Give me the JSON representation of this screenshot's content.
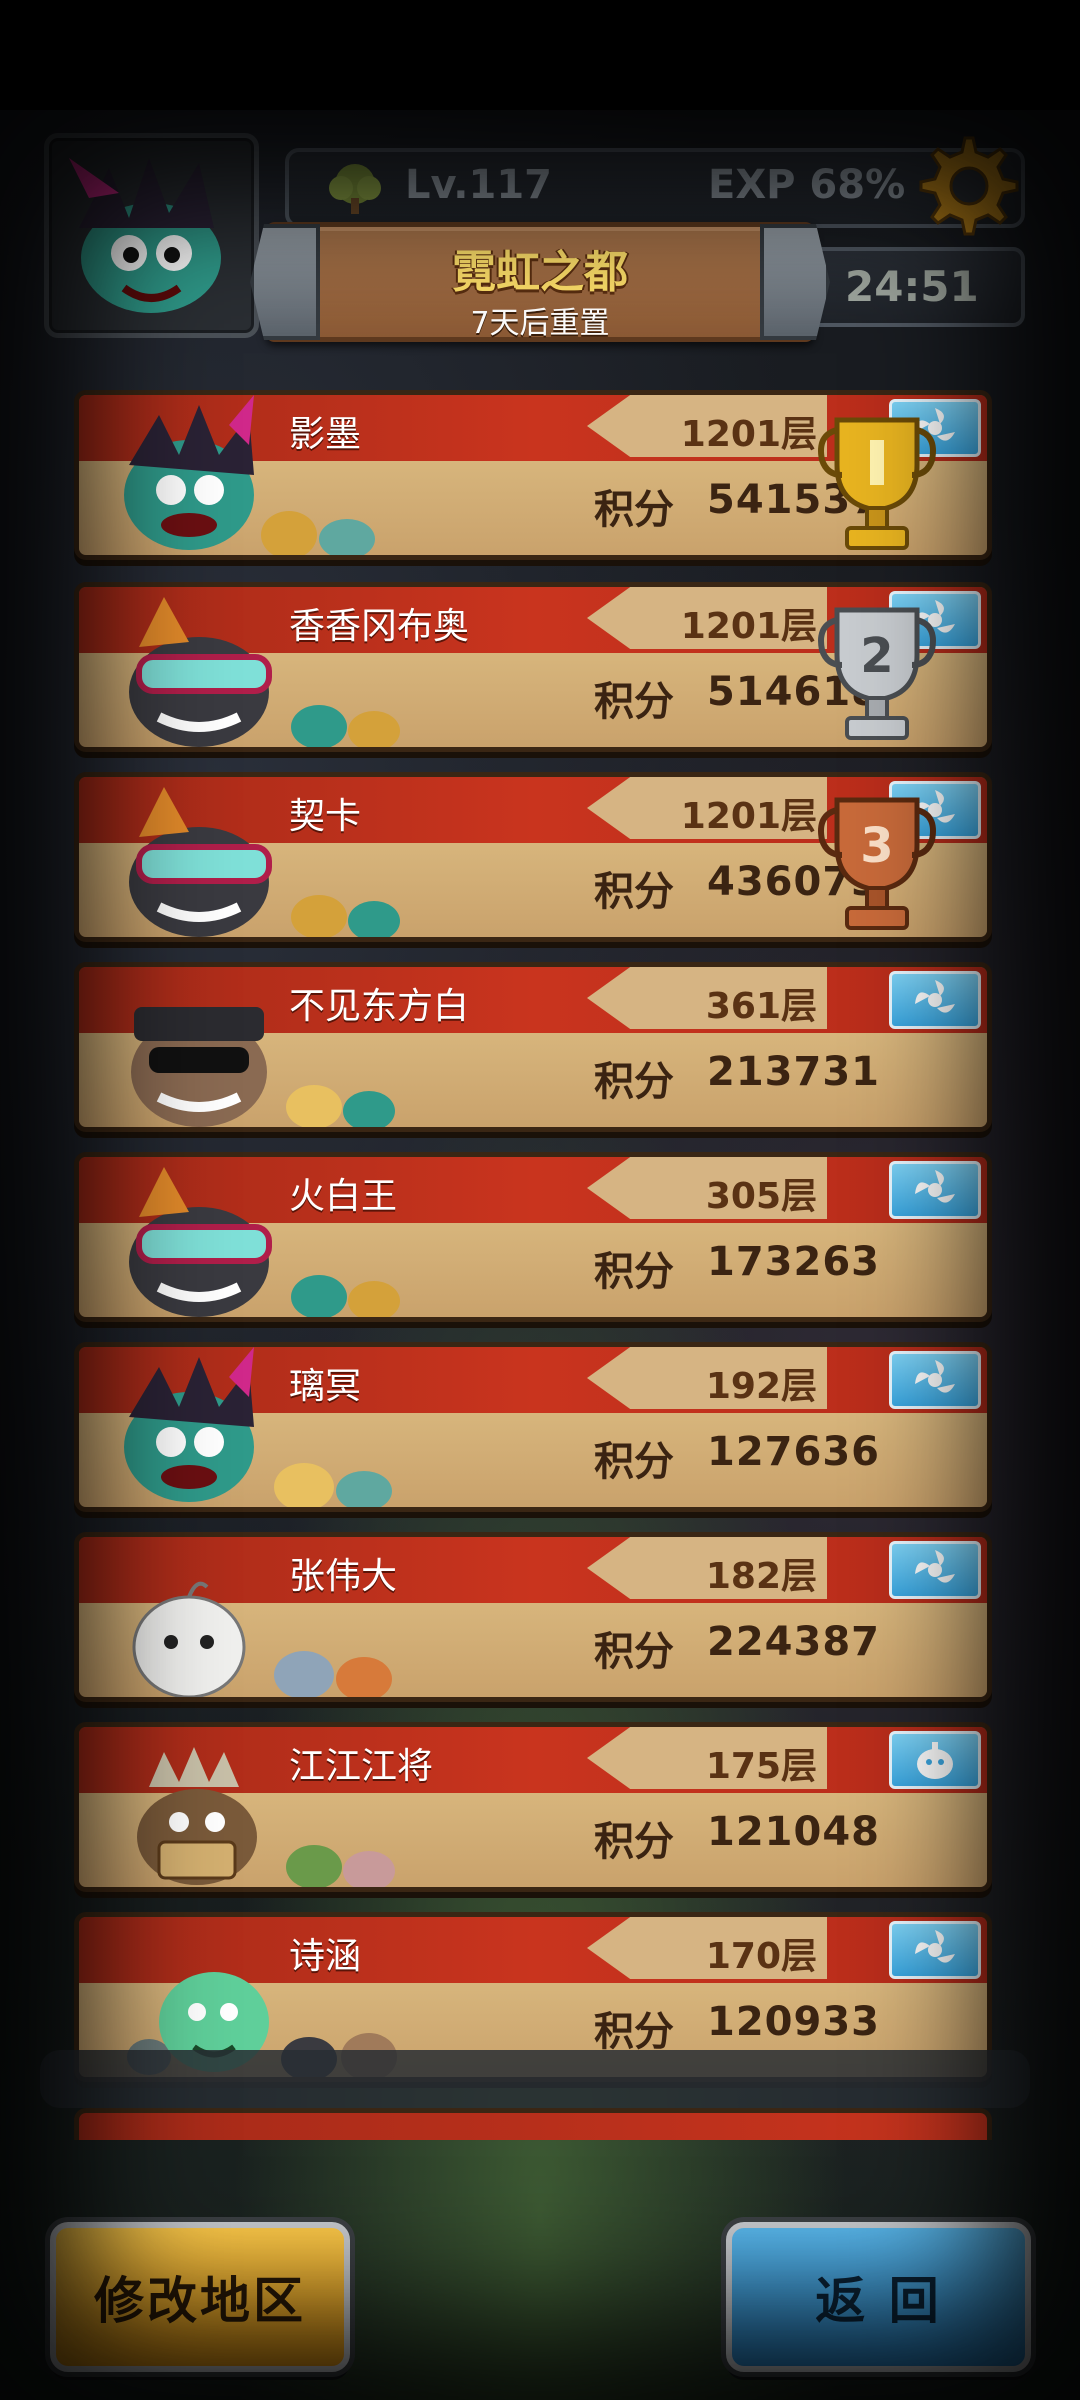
{
  "header": {
    "level": "Lv.117",
    "exp": "EXP  68%",
    "title": "霓虹之都",
    "reset_note": "7天后重置",
    "timer": "24:51"
  },
  "leaderboard": [
    {
      "name": "影墨",
      "floor": "1201层",
      "score_label": "积分",
      "score": "541537",
      "rank_trophy": "gold",
      "class_icon": "fan-icon"
    },
    {
      "name": "香香冈布奥",
      "floor": "1201层",
      "score_label": "积分",
      "score": "514618",
      "rank_trophy": "silver",
      "class_icon": "fan-icon"
    },
    {
      "name": "契卡",
      "floor": "1201层",
      "score_label": "积分",
      "score": "436073",
      "rank_trophy": "bronze",
      "class_icon": "fan-icon"
    },
    {
      "name": "不见东方白",
      "floor": "361层",
      "score_label": "积分",
      "score": "213731",
      "class_icon": "fan-icon"
    },
    {
      "name": "火白王",
      "floor": "305层",
      "score_label": "积分",
      "score": "173263",
      "class_icon": "fan-icon"
    },
    {
      "name": "璃冥",
      "floor": "192层",
      "score_label": "积分",
      "score": "127636",
      "class_icon": "fan-icon"
    },
    {
      "name": "张伟大",
      "floor": "182层",
      "score_label": "积分",
      "score": "224387",
      "class_icon": "fan-icon"
    },
    {
      "name": "江江江将",
      "floor": "175层",
      "score_label": "积分",
      "score": "121048",
      "class_icon": "pumpkin-icon"
    },
    {
      "name": "诗涵",
      "floor": "170层",
      "score_label": "积分",
      "score": "120933",
      "class_icon": "fan-icon"
    }
  ],
  "buttons": {
    "change_region": "修改地区",
    "back": "返 回"
  },
  "colors": {
    "card_stripe": "#c9341e",
    "card_body": "#d7b57c",
    "title_text": "#ffe06a",
    "btn_yellow": "#ffcb4a",
    "btn_blue": "#3aa6e0"
  }
}
